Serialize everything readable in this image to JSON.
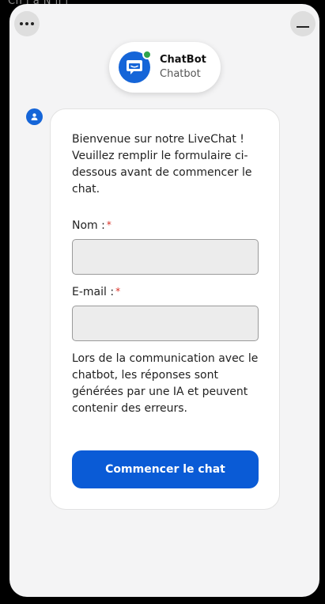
{
  "background": {
    "text": "Ch i a  N ll i"
  },
  "controls": {
    "more_icon": "ellipsis-icon",
    "minimize_icon": "minimize-icon"
  },
  "header": {
    "name": "ChatBot",
    "subtitle": "Chatbot",
    "status": "online",
    "status_color": "#2fa34b"
  },
  "message": {
    "welcome": "Bienvenue sur notre LiveChat ! Veuillez remplir le formulaire ci-dessous avant de commencer le chat.",
    "fields": [
      {
        "label": "Nom :",
        "required_mark": "*",
        "value": ""
      },
      {
        "label": "E-mail :",
        "required_mark": "*",
        "value": ""
      }
    ],
    "disclaimer": "Lors de la communication avec le chatbot, les réponses sont générées par une IA et peuvent contenir des erreurs.",
    "submit_label": "Commencer le chat"
  },
  "colors": {
    "accent": "#0a5bd6",
    "avatar": "#1565d8",
    "required": "#d93025"
  }
}
